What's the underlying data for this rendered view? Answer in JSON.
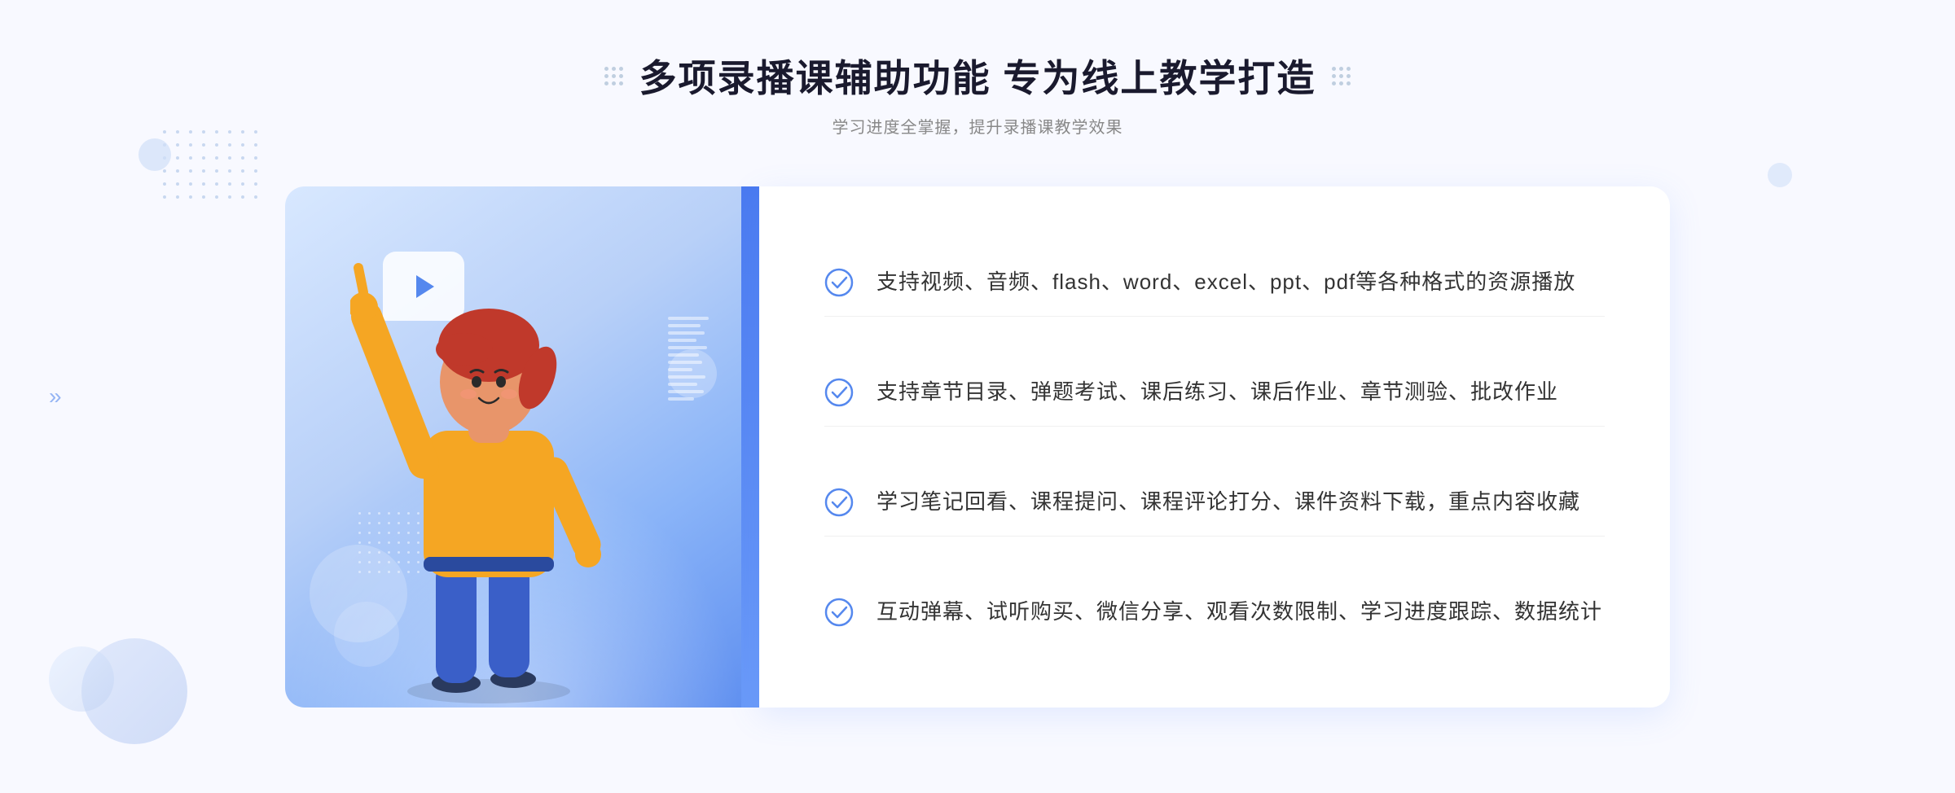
{
  "header": {
    "title": "多项录播课辅助功能 专为线上教学打造",
    "subtitle": "学习进度全掌握，提升录播课教学效果"
  },
  "features": [
    {
      "id": 1,
      "text": "支持视频、音频、flash、word、excel、ppt、pdf等各种格式的资源播放"
    },
    {
      "id": 2,
      "text": "支持章节目录、弹题考试、课后练习、课后作业、章节测验、批改作业"
    },
    {
      "id": 3,
      "text": "学习笔记回看、课程提问、课程评论打分、课件资料下载，重点内容收藏"
    },
    {
      "id": 4,
      "text": "互动弹幕、试听购买、微信分享、观看次数限制、学习进度跟踪、数据统计"
    }
  ],
  "colors": {
    "accent": "#4a7af0",
    "title": "#1a1a2e",
    "text": "#333333",
    "subtitle": "#888888",
    "check": "#5588ee",
    "cardBg": "white",
    "leftCardGradient": "linear-gradient(145deg, #d8e8ff, #6090f0)"
  },
  "icons": {
    "check": "check-circle",
    "play": "play-triangle",
    "chevron": "double-chevron-right"
  }
}
